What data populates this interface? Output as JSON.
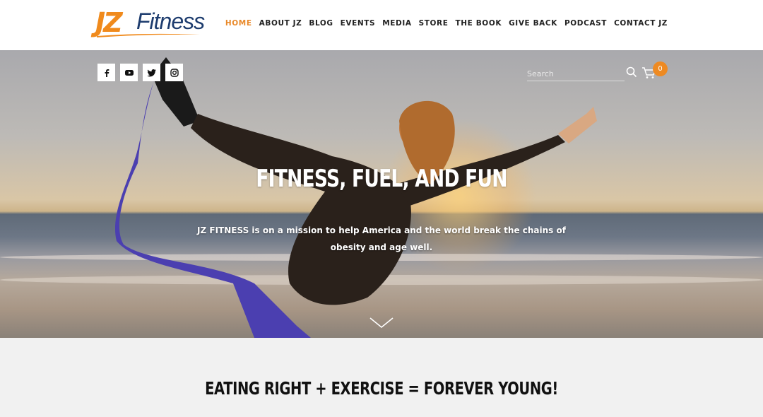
{
  "logo": {
    "part1": "JZ",
    "part2": "Fitness"
  },
  "nav": {
    "items": [
      {
        "label": "HOME",
        "active": true
      },
      {
        "label": "ABOUT JZ"
      },
      {
        "label": "BLOG"
      },
      {
        "label": "EVENTS"
      },
      {
        "label": "MEDIA"
      },
      {
        "label": "STORE"
      },
      {
        "label": "THE BOOK"
      },
      {
        "label": "GIVE BACK"
      },
      {
        "label": "PODCAST"
      },
      {
        "label": "CONTACT JZ"
      }
    ]
  },
  "social": [
    "facebook-icon",
    "youtube-icon",
    "twitter-icon",
    "instagram-icon"
  ],
  "search": {
    "placeholder": "Search",
    "value": ""
  },
  "cart": {
    "count": "0"
  },
  "hero": {
    "title": "FITNESS, FUEL, AND FUN",
    "text": "JZ FITNESS is on a mission to help America and the world break the chains of obesity and age well."
  },
  "section": {
    "title": "EATING RIGHT + EXERCISE = FOREVER YOUNG!"
  },
  "colors": {
    "accent": "#ee8a22",
    "brand_blue": "#1d3c6e",
    "section_bg": "#f1f1f1"
  }
}
